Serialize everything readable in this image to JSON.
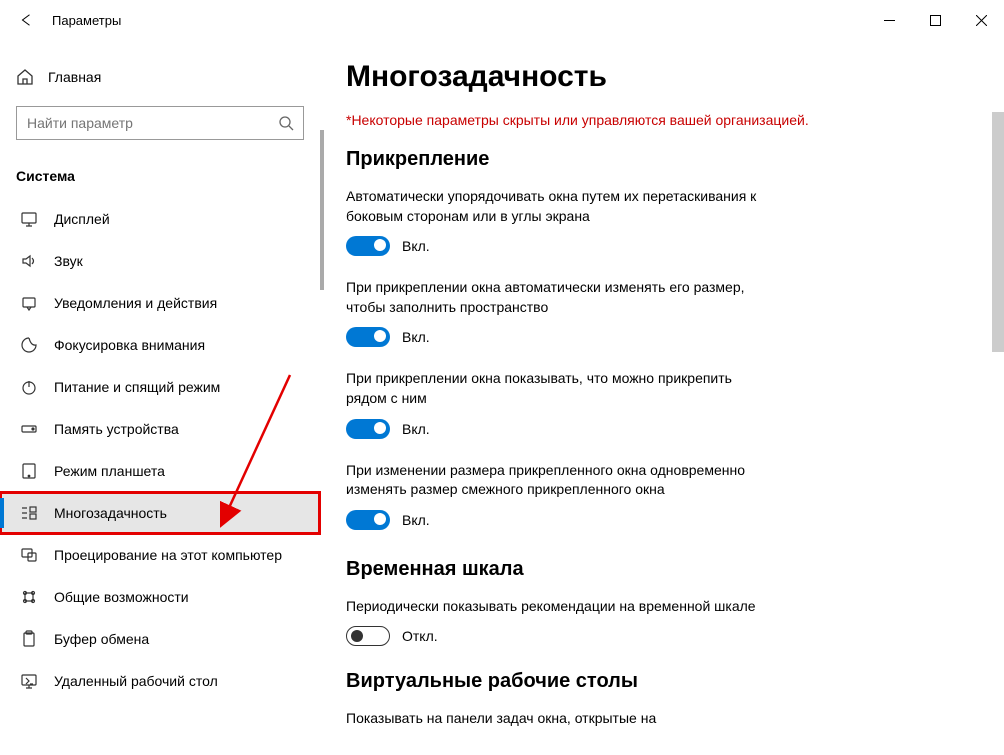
{
  "window": {
    "title": "Параметры"
  },
  "sidebar": {
    "home": "Главная",
    "search_placeholder": "Найти параметр",
    "section": "Система",
    "items": [
      {
        "label": "Дисплей",
        "icon": "display"
      },
      {
        "label": "Звук",
        "icon": "sound"
      },
      {
        "label": "Уведомления и действия",
        "icon": "notifications"
      },
      {
        "label": "Фокусировка внимания",
        "icon": "focus"
      },
      {
        "label": "Питание и спящий режим",
        "icon": "power"
      },
      {
        "label": "Память устройства",
        "icon": "storage"
      },
      {
        "label": "Режим планшета",
        "icon": "tablet"
      },
      {
        "label": "Многозадачность",
        "icon": "multitask",
        "selected": true,
        "highlighted": true
      },
      {
        "label": "Проецирование на этот компьютер",
        "icon": "project"
      },
      {
        "label": "Общие возможности",
        "icon": "share"
      },
      {
        "label": "Буфер обмена",
        "icon": "clipboard"
      },
      {
        "label": "Удаленный рабочий стол",
        "icon": "remote"
      }
    ]
  },
  "main": {
    "title": "Многозадачность",
    "org_notice": "*Некоторые параметры скрыты или управляются вашей организацией.",
    "snap": {
      "heading": "Прикрепление",
      "items": [
        {
          "desc": "Автоматически упорядочивать окна путем их перетаскивания к боковым сторонам или в углы экрана",
          "state": "on",
          "label": "Вкл."
        },
        {
          "desc": "При прикреплении окна автоматически изменять его размер, чтобы заполнить пространство",
          "state": "on",
          "label": "Вкл."
        },
        {
          "desc": "При прикреплении окна показывать, что можно прикрепить рядом с ним",
          "state": "on",
          "label": "Вкл."
        },
        {
          "desc": "При изменении размера прикрепленного окна одновременно изменять размер смежного прикрепленного окна",
          "state": "on",
          "label": "Вкл."
        }
      ]
    },
    "timeline": {
      "heading": "Временная шкала",
      "desc": "Периодически показывать рекомендации на временной шкале",
      "state": "off",
      "label": "Откл."
    },
    "virtual": {
      "heading": "Виртуальные рабочие столы",
      "desc": "Показывать на панели задач окна, открытые на"
    }
  }
}
